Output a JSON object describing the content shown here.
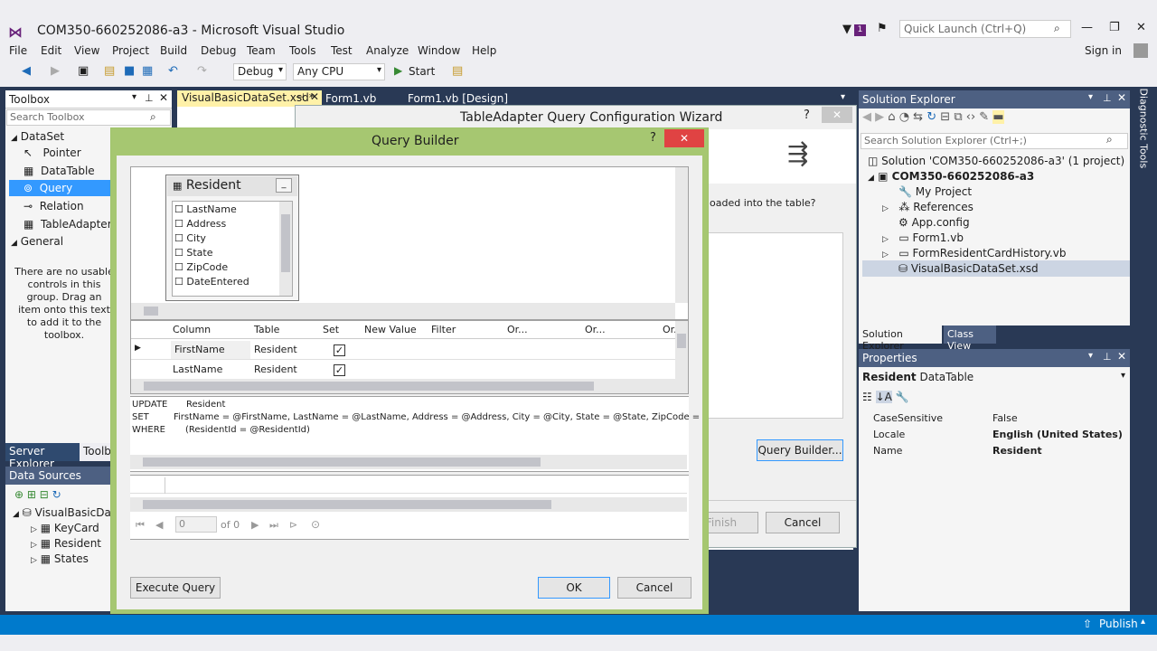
{
  "window": {
    "title": "COM350-660252086-a3 - Microsoft Visual Studio",
    "notif_count": "1",
    "quick_launch_placeholder": "Quick Launch (Ctrl+Q)",
    "sign_in": "Sign in"
  },
  "menu": [
    "File",
    "Edit",
    "View",
    "Project",
    "Build",
    "Debug",
    "Team",
    "Tools",
    "Test",
    "Analyze",
    "Window",
    "Help"
  ],
  "toolbar": {
    "config": "Debug",
    "platform": "Any CPU",
    "start": "Start"
  },
  "tabs": [
    "VisualBasicDataSet.xsd*",
    "Form1.vb",
    "Form1.vb [Design]"
  ],
  "toolbox": {
    "title": "Toolbox",
    "search_placeholder": "Search Toolbox",
    "group_dataset": "DataSet",
    "items": [
      "Pointer",
      "DataTable",
      "Query",
      "Relation",
      "TableAdapter"
    ],
    "group_general": "General",
    "general_text": "There are no usable controls in this group. Drag an item onto this text to add it to the toolbox."
  },
  "left_tabs": {
    "server_explorer": "Server Explorer",
    "toolbox": "Toolbox"
  },
  "datasources": {
    "title": "Data Sources",
    "root": "VisualBasicDataSet",
    "tables": [
      "KeyCard",
      "Resident",
      "States"
    ]
  },
  "wizard": {
    "title": "TableAdapter Query Configuration Wizard",
    "question_fragment": "oaded into the table?",
    "query_builder_btn": "Query Builder...",
    "finish_btn": "Finish",
    "cancel_btn": "Cancel"
  },
  "query_builder": {
    "title": "Query Builder",
    "help": "?",
    "table_name": "Resident",
    "table_columns": [
      "LastName",
      "Address",
      "City",
      "State",
      "ZipCode",
      "DateEntered"
    ],
    "grid_headers": [
      "Column",
      "Table",
      "Set",
      "New Value",
      "Filter",
      "Or...",
      "Or...",
      "Or..."
    ],
    "grid_rows": [
      {
        "column": "FirstName",
        "table": "Resident",
        "set": "✓"
      },
      {
        "column": "LastName",
        "table": "Resident",
        "set": "✓"
      }
    ],
    "sql": {
      "kw1": "UPDATE",
      "val1": "Resident",
      "kw2": "SET",
      "val2": "FirstName = @FirstName, LastName = @LastName, Address = @Address, City = @City, State = @State, ZipCode =",
      "kw3": "WHERE",
      "val3": "(ResidentId = @ResidentId)"
    },
    "nav": {
      "position": "0",
      "of": "of 0"
    },
    "execute_btn": "Execute Query",
    "ok_btn": "OK",
    "cancel_btn": "Cancel"
  },
  "solution_explorer": {
    "title": "Solution Explorer",
    "search_placeholder": "Search Solution Explorer (Ctrl+;)",
    "solution": "Solution 'COM350-660252086-a3' (1 project)",
    "project": "COM350-660252086-a3",
    "items": [
      "My Project",
      "References",
      "App.config",
      "Form1.vb",
      "FormResidentCardHistory.vb",
      "VisualBasicDataSet.xsd"
    ],
    "bottom_tabs": [
      "Solution Explorer",
      "Class View"
    ]
  },
  "properties": {
    "title": "Properties",
    "object_name": "Resident",
    "object_type": "DataTable",
    "rows": [
      {
        "name": "CaseSensitive",
        "value": "False"
      },
      {
        "name": "Locale",
        "value": "English (United States)"
      },
      {
        "name": "Name",
        "value": "Resident"
      }
    ]
  },
  "diagnostic_tools": "Diagnostic Tools",
  "status": {
    "publish": "Publish"
  }
}
